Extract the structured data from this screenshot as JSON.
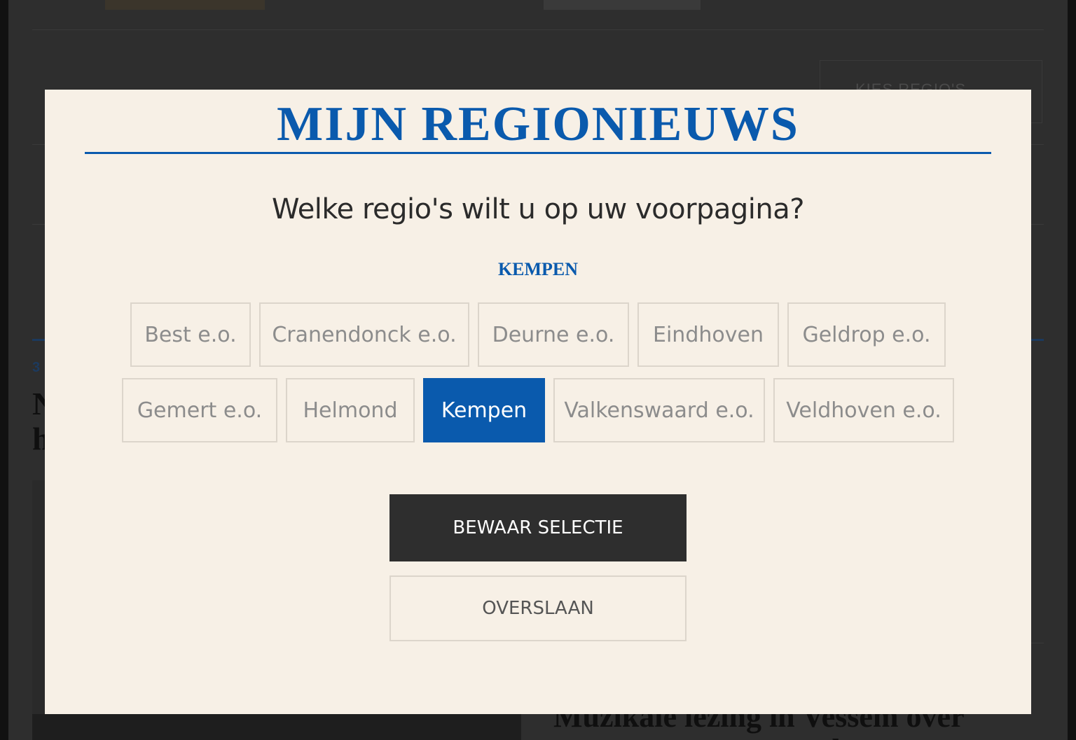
{
  "background": {
    "regio_button_label": "KIES REGIO'S",
    "regio_button_chevron": "⌄",
    "date_fragment": "3",
    "headline_fragment": "N\nh",
    "headline2_fragment": "Muzikale lezing in Vessem over\nt                              B d"
  },
  "modal": {
    "title": "MIJN REGIONIEUWS",
    "question": "Welke regio's wilt u op uw voorpagina?",
    "selected_summary": "KEMPEN",
    "regions": [
      {
        "label": "Best e.o.",
        "selected": false
      },
      {
        "label": "Cranendonck e.o.",
        "selected": false
      },
      {
        "label": "Deurne e.o.",
        "selected": false
      },
      {
        "label": "Eindhoven",
        "selected": false
      },
      {
        "label": "Geldrop e.o.",
        "selected": false
      },
      {
        "label": "Gemert e.o.",
        "selected": false
      },
      {
        "label": "Helmond",
        "selected": false
      },
      {
        "label": "Kempen",
        "selected": true
      },
      {
        "label": "Valkenswaard e.o.",
        "selected": false
      },
      {
        "label": "Veldhoven e.o.",
        "selected": false
      }
    ],
    "save_label": "BEWAAR SELECTIE",
    "skip_label": "OVERSLAAN"
  },
  "colors": {
    "brand_blue": "#0a5aad",
    "modal_background": "#f7f0e6",
    "primary_button": "#2e2e2e"
  }
}
